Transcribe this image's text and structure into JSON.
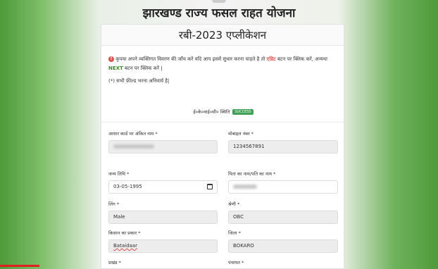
{
  "header": {
    "title": "झारखण्ड राज्य फसल राहत योजना"
  },
  "card": {
    "title": "रबी-2023 एप्लीकेशन"
  },
  "notice": {
    "icon": "warning-icon",
    "text_before": "कृपया अपने व्यक्तिगत विवरण की जाँच करें यदि आप इसमें सुधार करना चाहते है तो",
    "edit_word": "एडिट",
    "text_middle": "बटन पर क्लिक करें, अन्यथा",
    "next_word": "NEXT",
    "text_after": "बटन पर क्लिक करें |",
    "required_note": "(*) सभी फ़ील्ड भरना अनिवार्य है|"
  },
  "kyc": {
    "label": "ई०के०वाई०सी० स्थिति",
    "status": "SUCCESS"
  },
  "fields": {
    "aadhaar_name": {
      "label": "आधार कार्ड पर अंकित नाम *",
      "value": ""
    },
    "mobile": {
      "label": "मोबाइल नंबर *",
      "value": "1234567891"
    },
    "dob": {
      "label": "जन्म तिथि *",
      "value": "03-05-1995"
    },
    "father_name": {
      "label": "पिता का नाम/पति का नाम *",
      "value": ""
    },
    "gender": {
      "label": "लिंग *",
      "value": "Male"
    },
    "category": {
      "label": "श्रेणी *",
      "value": "OBC"
    },
    "farmer_type": {
      "label": "किसान का प्रकार *",
      "value": "Bataidaar"
    },
    "district": {
      "label": "जिला *",
      "value": "BOKARO"
    },
    "block": {
      "label": "प्रखंड *"
    },
    "panchayat": {
      "label": "पंचायत *"
    }
  },
  "colors": {
    "accent_red": "#d9534f",
    "accent_green": "#3a8a2a",
    "badge": "#3f9f54"
  }
}
